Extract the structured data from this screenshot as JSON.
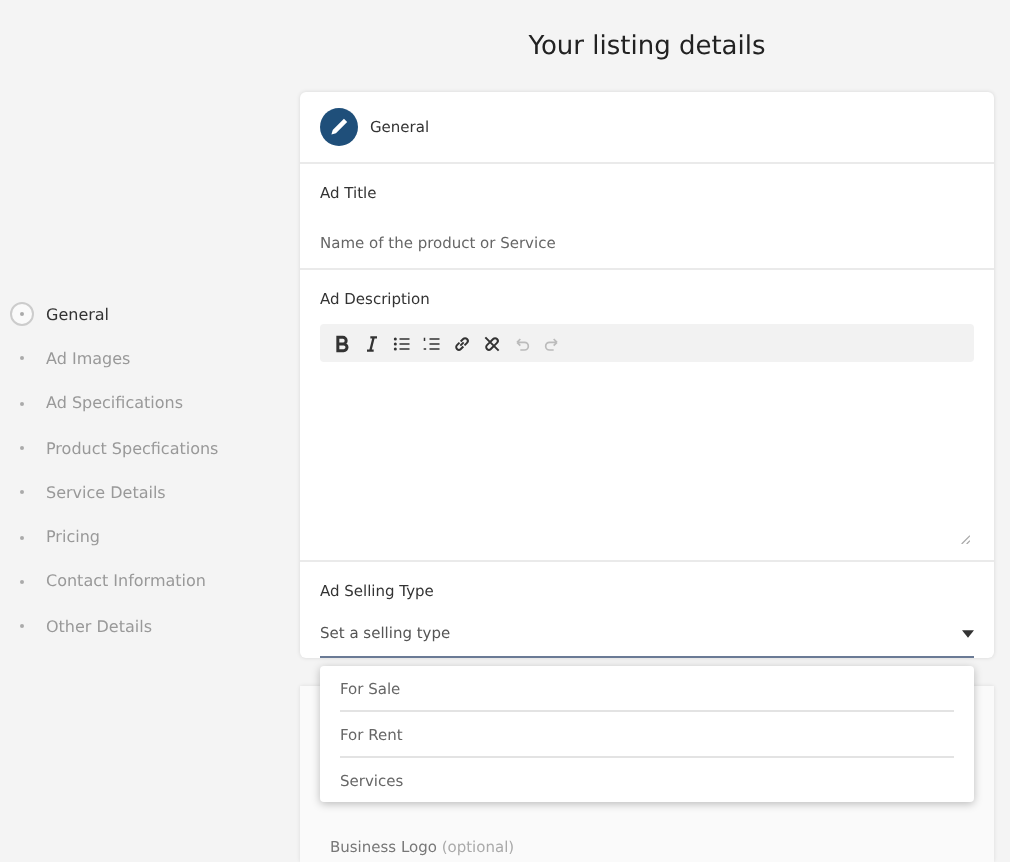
{
  "page_title": "Your listing details",
  "nav": [
    {
      "label": "General",
      "selected": true
    },
    {
      "label": "Ad Images",
      "selected": false
    },
    {
      "label": "Ad Specifications",
      "selected": false
    },
    {
      "label": "Product Specfications",
      "selected": false
    },
    {
      "label": "Service Details",
      "selected": false
    },
    {
      "label": "Pricing",
      "selected": false
    },
    {
      "label": "Contact Information",
      "selected": false
    },
    {
      "label": "Other Details",
      "selected": false
    }
  ],
  "section": {
    "title": "General"
  },
  "ad_title": {
    "label": "Ad Title",
    "placeholder": "Name of the product or Service"
  },
  "ad_description": {
    "label": "Ad Description",
    "toolbar": [
      {
        "kind": "bold",
        "disabled": false
      },
      {
        "kind": "italic",
        "disabled": false
      },
      {
        "kind": "bullets",
        "disabled": false
      },
      {
        "kind": "numbers",
        "disabled": false
      },
      {
        "kind": "link",
        "disabled": false
      },
      {
        "kind": "unlink",
        "disabled": false
      },
      {
        "kind": "undo",
        "disabled": true
      },
      {
        "kind": "redo",
        "disabled": true
      }
    ]
  },
  "selling_type": {
    "label": "Ad Selling Type",
    "placeholder": "Set a selling type",
    "expanded": true,
    "options": [
      "For Sale",
      "For Rent",
      "Services"
    ]
  },
  "next_card": {
    "label": "Business Logo",
    "hint": "(optional)"
  }
}
